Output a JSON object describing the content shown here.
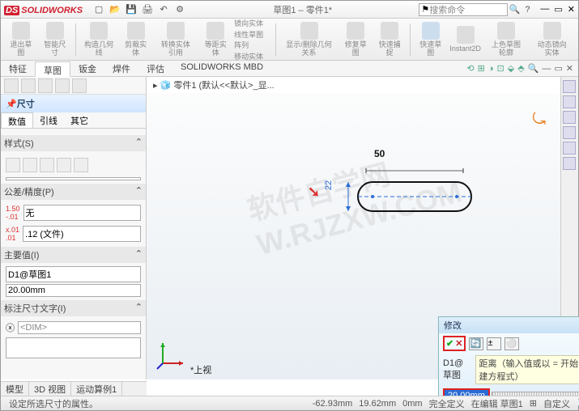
{
  "app": {
    "name": "SOLIDWORKS",
    "doc_title": "草图1 – 零件1*",
    "search_placeholder": "搜索命令"
  },
  "qat": [
    "new",
    "open",
    "save",
    "print",
    "rebuild",
    "options"
  ],
  "ribbon": [
    {
      "label": "退出草图"
    },
    {
      "label": "智能尺寸"
    },
    {
      "sep": true
    },
    {
      "label": "构造几何线"
    },
    {
      "label": "剪裁实体"
    },
    {
      "label": "转换实体引用"
    },
    {
      "label": "等距实体"
    },
    {
      "label": "镜向实体"
    },
    {
      "label": "线性草图阵列"
    },
    {
      "label": "移动实体"
    },
    {
      "sep": true
    },
    {
      "label": "显示/删除几何关系"
    },
    {
      "label": "修复草图"
    },
    {
      "label": "快速捕捉"
    },
    {
      "sep": true
    },
    {
      "label": "快速草图"
    },
    {
      "label": "Instant2D"
    },
    {
      "label": "上色草图轮廓"
    },
    {
      "label": "动态镜向实体"
    }
  ],
  "tabs": [
    "特征",
    "草图",
    "钣金",
    "焊件",
    "评估",
    "SOLIDWORKS MBD"
  ],
  "active_tab": 1,
  "breadcrumb": "零件1 (默认<<默认>_显...",
  "panel": {
    "title": "尺寸",
    "subtabs": [
      "数值",
      "引线",
      "其它"
    ],
    "active_subtab": 0,
    "groups": {
      "style": "样式(S)",
      "tolerance": "公差/精度(P)",
      "tol_val": "无",
      "precision": ".12 (文件)",
      "precision_prefix": "1.50 .01",
      "primary": "主要值(I)",
      "primary_name": "D1@草图1",
      "primary_val": "20.00mm",
      "dimtext": "标注尺寸文字(I)",
      "dimtext_val": "<DIM>"
    }
  },
  "viewport": {
    "watermark": "软件自学网\nW.RJZXW.COM",
    "dim_h": "50",
    "dim_v": "22",
    "view_label": "*上视"
  },
  "modify": {
    "title": "修改",
    "d1": "D1@草图",
    "hint": "距离（输入值或以 = 开始，以创建方程式）",
    "value": "20.00mm"
  },
  "bottomtabs": [
    "模型",
    "3D 视图",
    "运动算例1"
  ],
  "status": {
    "left": "设定所选尺寸的属性。",
    "x": "-62.93mm",
    "y": "19.62mm",
    "z": "0mm",
    "def": "完全定义",
    "mode": "在编辑 草图1",
    "custom": "自定义"
  }
}
